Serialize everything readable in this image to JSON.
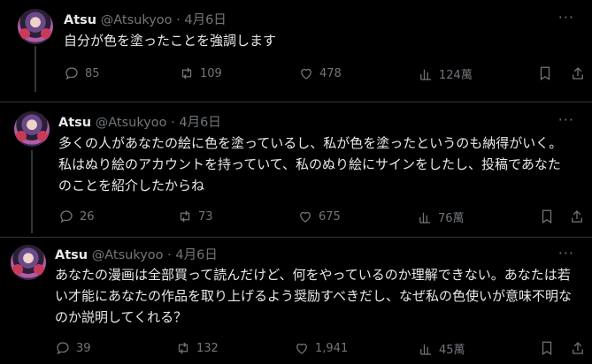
{
  "tweets": [
    {
      "name": "Atsu",
      "handle": "@Atsukyoo",
      "separator": "·",
      "date": "4月6日",
      "text": "自分が色を塗ったことを強調します",
      "replies": "85",
      "retweets": "109",
      "likes": "478",
      "views": "124萬"
    },
    {
      "name": "Atsu",
      "handle": "@Atsukyoo",
      "separator": "·",
      "date": "4月6日",
      "text": "多くの人があなたの絵に色を塗っているし、私が色を塗ったというのも納得がいく。私はぬり絵のアカウントを持っていて、私のぬり絵にサインをしたし、投稿であなたのことを紹介したからね",
      "replies": "26",
      "retweets": "73",
      "likes": "675",
      "views": "76萬"
    },
    {
      "name": "Atsu",
      "handle": "@Atsukyoo",
      "separator": "·",
      "date": "4月6日",
      "text": "あなたの漫画は全部買って読んだけど、何をやっているのか理解できない。あなたは若い才能にあなたの作品を取り上げるよう奨励すべきだし、なぜ私の色使いが意味不明なのか説明してくれる？",
      "replies": "39",
      "retweets": "132",
      "likes": "1,941",
      "views": "45萬"
    }
  ],
  "more_glyph": "···",
  "colors": {
    "background": "#000000",
    "text": "#e7e9ea",
    "muted": "#71767b",
    "divider": "#2f3336"
  }
}
